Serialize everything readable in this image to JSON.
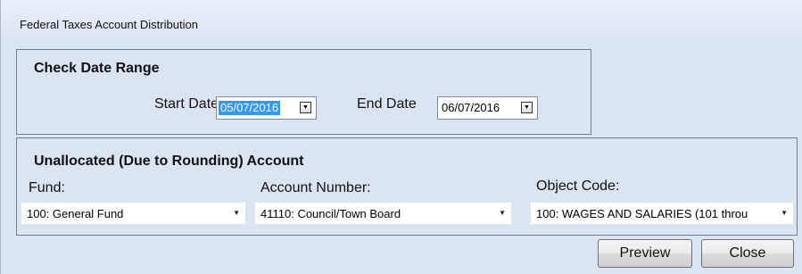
{
  "window": {
    "title": "Federal Taxes Account Distribution"
  },
  "check_date_range": {
    "title": "Check Date Range",
    "start_label": "Start Date",
    "start_value": "05/07/2016",
    "end_label": "End Date",
    "end_value": "06/07/2016"
  },
  "unallocated": {
    "title": "Unallocated (Due to Rounding) Account",
    "fund_label": "Fund:",
    "fund_value": "100: General Fund",
    "account_label": "Account Number:",
    "account_value": "41110: Council/Town Board",
    "object_label": "Object Code:",
    "object_value": "100: WAGES AND SALARIES (101 throu"
  },
  "buttons": {
    "preview": "Preview",
    "close": "Close"
  },
  "icons": {
    "date_dropdown": "calendar-dropdown-icon",
    "combo_dropdown": "chevron-down-icon"
  }
}
